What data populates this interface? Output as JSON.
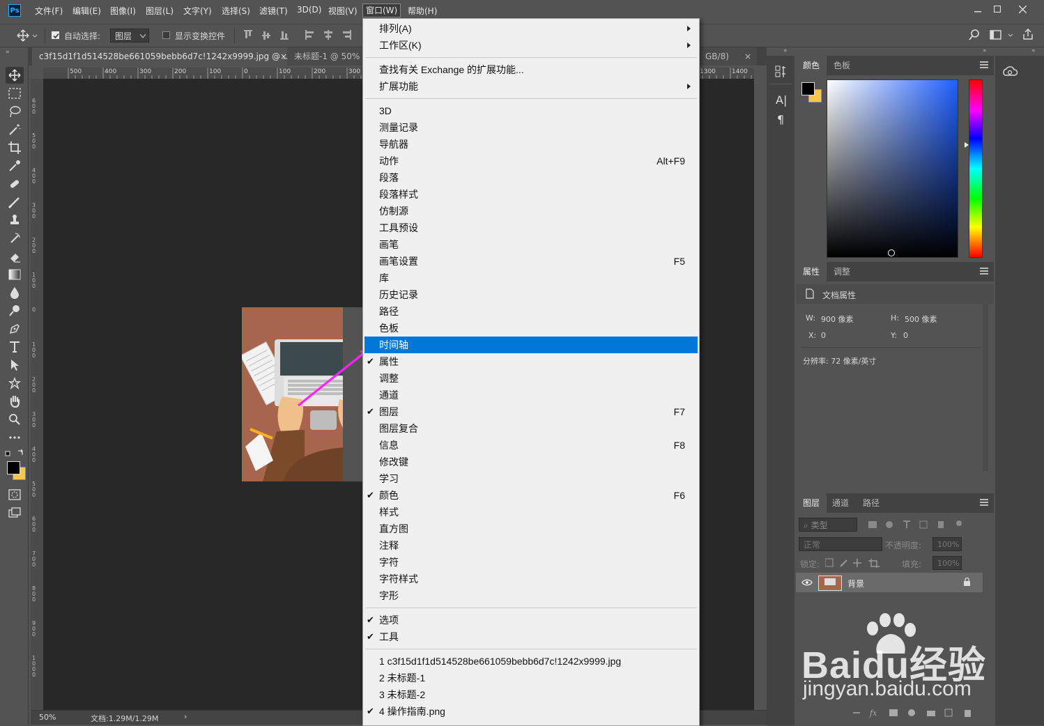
{
  "app": {
    "logo": "Ps"
  },
  "menubar": {
    "items": [
      "文件(F)",
      "编辑(E)",
      "图像(I)",
      "图层(L)",
      "文字(Y)",
      "选择(S)",
      "滤镜(T)",
      "3D(D)",
      "视图(V)",
      "窗口(W)",
      "帮助(H)"
    ],
    "active": "窗口(W)",
    "window_controls": [
      "minimize",
      "maximize",
      "close"
    ]
  },
  "options_bar": {
    "auto_select_label": "自动选择:",
    "auto_select_checked": true,
    "auto_select_value": "图层",
    "transform_controls_label": "显示变换控件",
    "transform_controls_checked": false
  },
  "doc_tabs": [
    {
      "title": "c3f15d1f1d514528be661059bebb6d7c!1242x9999.jpg @ ...",
      "active": true
    },
    {
      "title": "未标题-1 @ 50%",
      "active": false
    },
    {
      "title": "GB/8)",
      "active": false
    }
  ],
  "ruler": {
    "h_left": [
      "500",
      "400",
      "300",
      "200",
      "100",
      "0",
      "100",
      "200",
      "300"
    ],
    "h_right": [
      "1300",
      "1400"
    ],
    "v": [
      "600",
      "500",
      "400",
      "300",
      "200",
      "100",
      "0",
      "100",
      "200",
      "300",
      "400",
      "500",
      "600",
      "700",
      "800",
      "900",
      "1000"
    ]
  },
  "status": {
    "zoom": "50%",
    "doc": "文档:1.29M/1.29M"
  },
  "color_panel": {
    "tabs": [
      "颜色",
      "色板"
    ],
    "fg": "#000000",
    "bg": "#f5c84b"
  },
  "properties_panel": {
    "tabs": [
      "属性",
      "调整"
    ],
    "heading": "文档属性",
    "w_label": "W:",
    "w_value": "900 像素",
    "h_label": "H:",
    "h_value": "500 像素",
    "x_label": "X:",
    "x_value": "0",
    "y_label": "Y:",
    "y_value": "0",
    "resolution": "分辨率: 72 像素/英寸"
  },
  "layers_panel": {
    "tabs": [
      "图层",
      "通道",
      "路径"
    ],
    "filter_label": "类型",
    "blend_mode": "正常",
    "opacity_label": "不透明度:",
    "opacity_value": "100%",
    "lock_label": "锁定:",
    "fill_label": "填充:",
    "fill_value": "100%",
    "layer_name": "背景"
  },
  "window_menu": {
    "items": [
      {
        "label": "排列(A)",
        "submenu": true
      },
      {
        "label": "工作区(K)",
        "submenu": true
      },
      {
        "sep": true
      },
      {
        "label": "查找有关 Exchange 的扩展功能..."
      },
      {
        "label": "扩展功能",
        "submenu": true
      },
      {
        "sep": true
      },
      {
        "label": "3D"
      },
      {
        "label": "测量记录"
      },
      {
        "label": "导航器"
      },
      {
        "label": "动作",
        "shortcut": "Alt+F9"
      },
      {
        "label": "段落"
      },
      {
        "label": "段落样式"
      },
      {
        "label": "仿制源"
      },
      {
        "label": "工具预设"
      },
      {
        "label": "画笔"
      },
      {
        "label": "画笔设置",
        "shortcut": "F5"
      },
      {
        "label": "库"
      },
      {
        "label": "历史记录"
      },
      {
        "label": "路径"
      },
      {
        "label": "色板"
      },
      {
        "label": "时间轴",
        "highlighted": true
      },
      {
        "label": "属性",
        "checked": true
      },
      {
        "label": "调整"
      },
      {
        "label": "通道"
      },
      {
        "label": "图层",
        "checked": true,
        "shortcut": "F7"
      },
      {
        "label": "图层复合"
      },
      {
        "label": "信息",
        "shortcut": "F8"
      },
      {
        "label": "修改键"
      },
      {
        "label": "学习"
      },
      {
        "label": "颜色",
        "checked": true,
        "shortcut": "F6"
      },
      {
        "label": "样式"
      },
      {
        "label": "直方图"
      },
      {
        "label": "注释"
      },
      {
        "label": "字符"
      },
      {
        "label": "字符样式"
      },
      {
        "label": "字形"
      },
      {
        "sep": true
      },
      {
        "label": "选项",
        "checked": true
      },
      {
        "label": "工具",
        "checked": true
      },
      {
        "sep": true
      },
      {
        "label": "1 c3f15d1f1d514528be661059bebb6d7c!1242x9999.jpg"
      },
      {
        "label": "2 未标题-1"
      },
      {
        "label": "3 未标题-2"
      },
      {
        "label": "4 操作指南.png",
        "checked": true
      }
    ]
  },
  "watermark": {
    "brand": "Baidu经验",
    "url": "jingyan.baidu.com"
  },
  "colors": {
    "highlight": "#0078d7",
    "arrow": "#ff22ff",
    "canvas_image_bg": "#a8654e"
  }
}
